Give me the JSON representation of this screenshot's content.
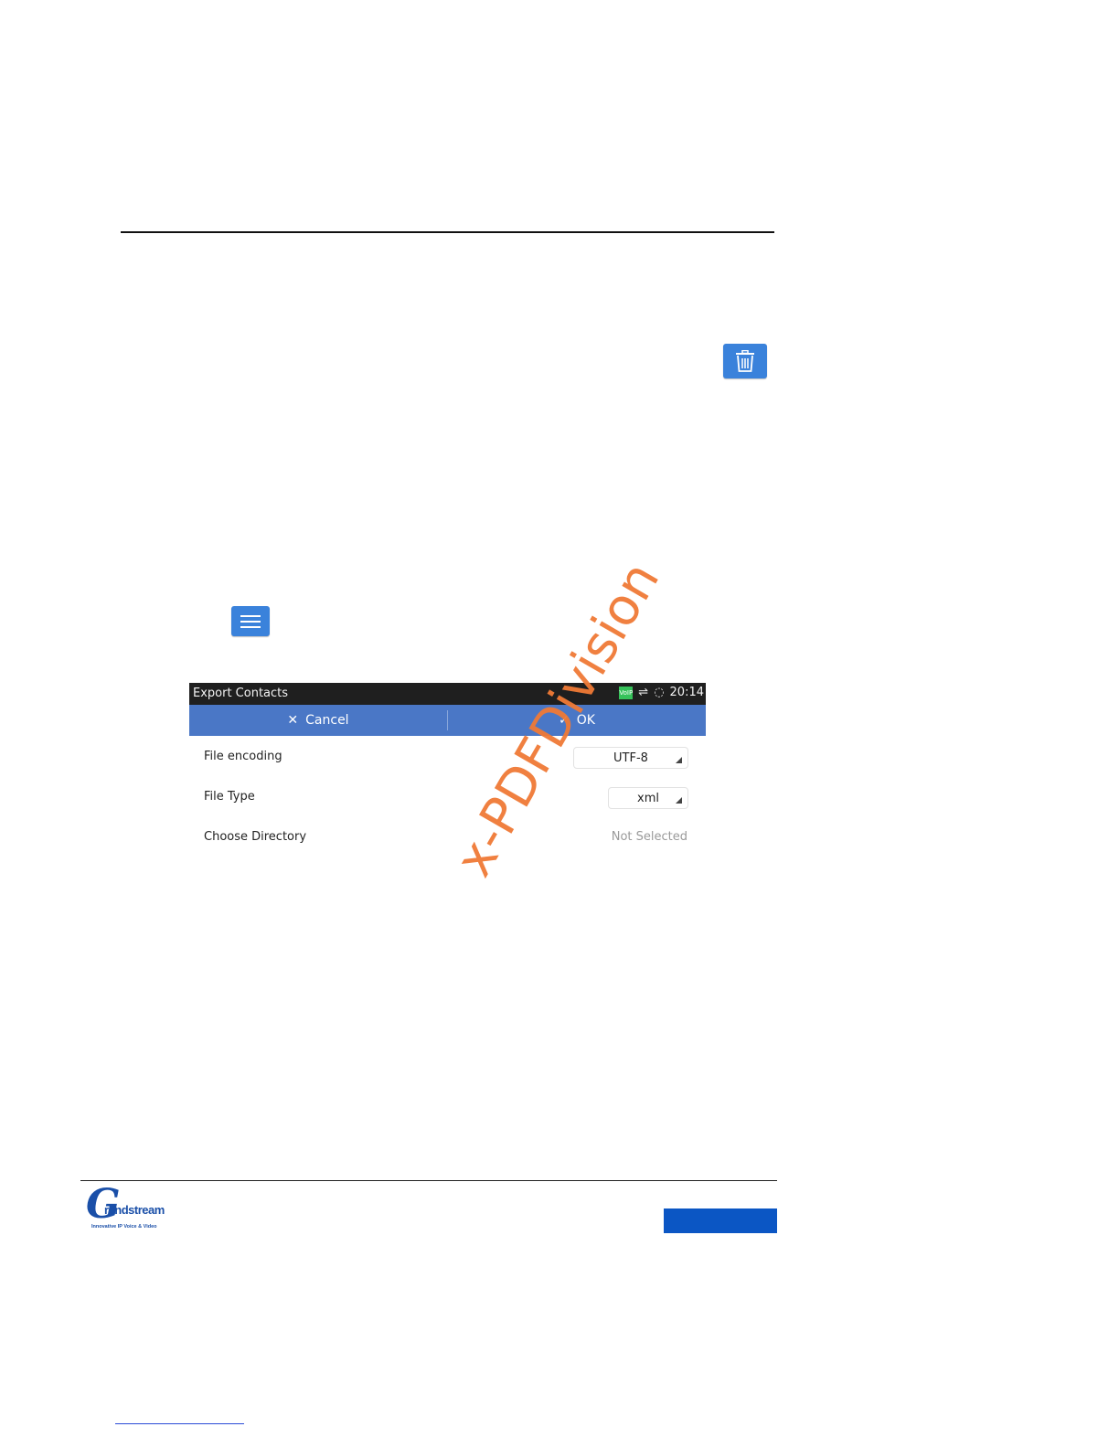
{
  "device_screen": {
    "status_bar": {
      "title": "Export Contacts",
      "voip_badge": "VoIP",
      "time": "20:14"
    },
    "action_bar": {
      "cancel_label": "Cancel",
      "ok_label": "OK"
    },
    "rows": [
      {
        "label": "File encoding",
        "value": "UTF-8"
      },
      {
        "label": "File Type",
        "value": "xml"
      },
      {
        "label": "Choose Directory",
        "value": "Not Selected"
      }
    ]
  },
  "watermark": "x-PDFDivision",
  "logo": {
    "brand": "Grandstream",
    "tagline": "Innovative IP Voice & Video"
  },
  "colors": {
    "button_blue": "#3a82db",
    "action_bar": "#4a77c6",
    "footer_bar": "#0b56c4",
    "watermark": "#f07a36"
  },
  "icons": {
    "delete_button": "trash-icon",
    "menu_button": "menu-icon"
  }
}
